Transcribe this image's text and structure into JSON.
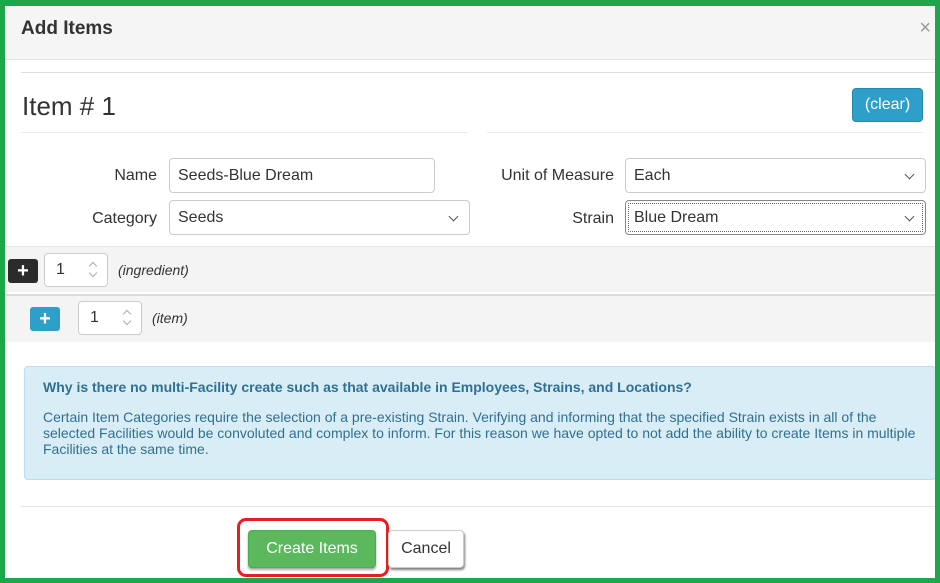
{
  "modal": {
    "title": "Add Items",
    "close_glyph": "×"
  },
  "item": {
    "heading": "Item # 1",
    "clear_label": "(clear)"
  },
  "form": {
    "name_label": "Name",
    "name_value": "Seeds-Blue Dream",
    "category_label": "Category",
    "category_value": "Seeds",
    "uom_label": "Unit of Measure",
    "uom_value": "Each",
    "strain_label": "Strain",
    "strain_value": "Blue Dream"
  },
  "ingredient_row": {
    "add_glyph": "+",
    "count": "1",
    "hint": "(ingredient)"
  },
  "item_row": {
    "add_glyph": "+",
    "count": "1",
    "hint": "(item)"
  },
  "info": {
    "title": "Why is there no multi-Facility create such as that available in Employees, Strains, and Locations?",
    "body": "Certain Item Categories require the selection of a pre-existing Strain. Verifying and informing that the specified Strain exists in all of the selected Facilities would be convoluted and complex to inform. For this reason we have opted to not add the ability to create Items in multiple Facilities at the same time."
  },
  "footer": {
    "create_label": "Create Items",
    "cancel_label": "Cancel"
  },
  "colors": {
    "frame_border": "#1fa64a",
    "primary": "#2d9fc9",
    "success": "#5cb85c",
    "info_bg": "#d9edf7",
    "info_text": "#31708f",
    "highlight": "#e32020"
  }
}
